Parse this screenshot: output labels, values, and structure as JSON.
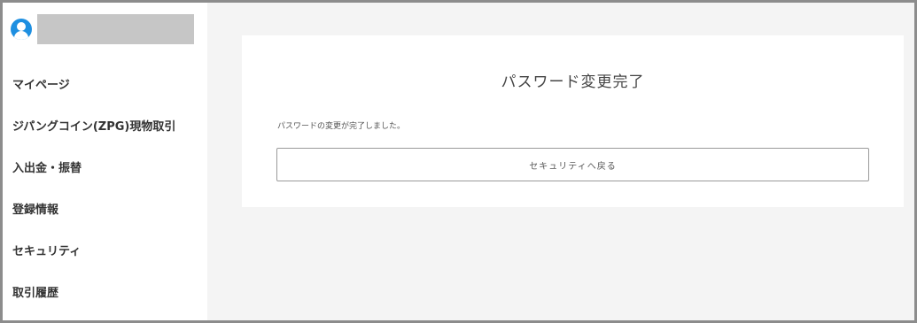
{
  "sidebar": {
    "user_icon": "user-avatar-icon",
    "items": [
      {
        "label": "マイページ"
      },
      {
        "label": "ジパングコイン(ZPG)現物取引"
      },
      {
        "label": "入出金・振替"
      },
      {
        "label": "登録情報"
      },
      {
        "label": "セキュリティ"
      },
      {
        "label": "取引履歴"
      }
    ]
  },
  "main": {
    "title": "パスワード変更完了",
    "message": "パスワードの変更が完了しました。",
    "back_button_label": "セキュリティへ戻る"
  },
  "colors": {
    "accent": "#1d8fe1",
    "background": "#f4f4f4",
    "redacted": "#c6c6c6"
  }
}
